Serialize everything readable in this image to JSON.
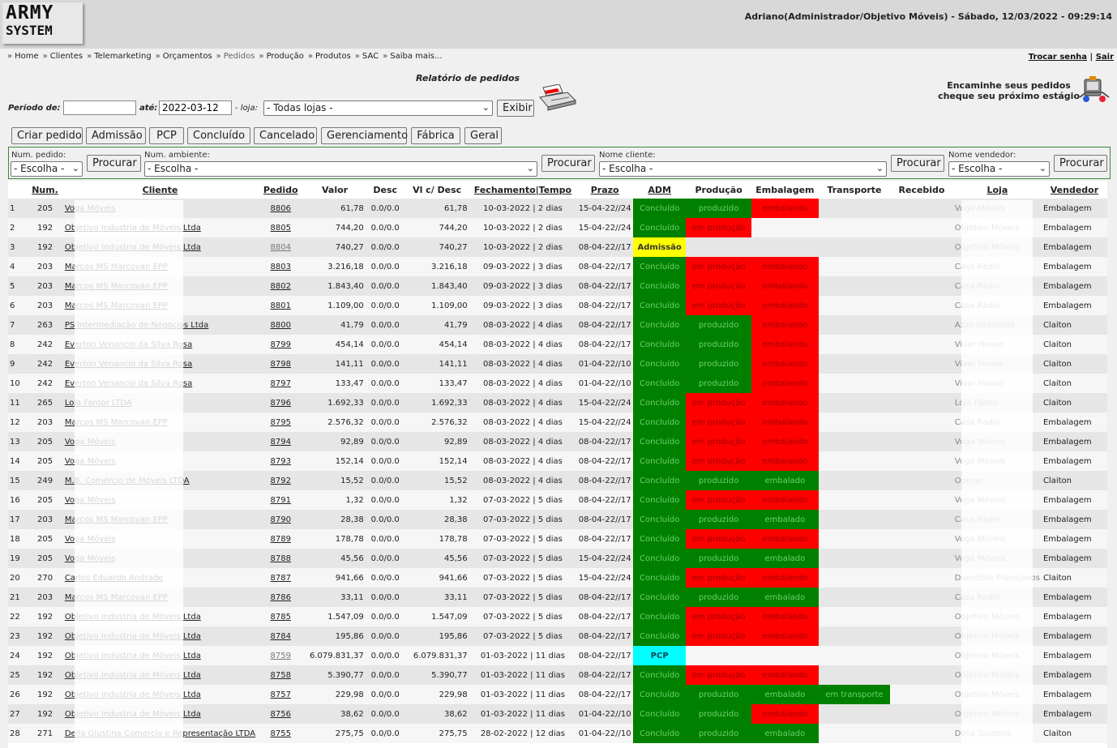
{
  "app": {
    "logo_line1": "ARMY",
    "logo_line2": "SYSTEM",
    "user_info": "Adriano(Administrador/Objetivo Móveis) - Sábado, 12/03/2022 - 09:29:14"
  },
  "nav": {
    "breadcrumb": [
      "Home",
      "Clientes",
      "Telemarketing",
      "Orçamentos",
      "Pedidos",
      "Produção",
      "Produtos",
      "SAC",
      "Saiba mais..."
    ],
    "current": "Pedidos",
    "change_password": "Trocar senha",
    "separator": "|",
    "logout": "Sair"
  },
  "report": {
    "title": "Relatório de pedidos",
    "tip_line1": "Encaminhe seus pedidos",
    "tip_line2": "cheque seu próximo estágio",
    "period_label": "Período de:",
    "period_from": "",
    "until_label": "até:",
    "period_to": "2022-03-12",
    "store_label": "- loja:",
    "store_value": "- Todas lojas -",
    "show_button": "Exibir"
  },
  "tabs": [
    "Criar pedido",
    "Admissão",
    "PCP",
    "Concluído",
    "Cancelado",
    "Gerenciamento",
    "Fábrica",
    "Geral"
  ],
  "filters": {
    "order_label": "Num. pedido:",
    "order_value": "- Escolha -",
    "env_label": "Num. ambiente:",
    "env_value": "- Escolha -",
    "client_label": "Nome cliente:",
    "client_value": "- Escolha -",
    "seller_label": "Nome vendedor:",
    "seller_value": "- Escolha -",
    "search_button": "Procurar"
  },
  "table": {
    "headers": [
      "",
      "Num.",
      "Cliente",
      "Pedido",
      "Valor",
      "Desc",
      "Vl c/ Desc",
      "Fechamento|Tempo",
      "Prazo",
      "ADM",
      "Produção",
      "Embalagem",
      "Transporte",
      "Recebido",
      "Loja",
      "Vendedor"
    ],
    "rows": [
      {
        "i": "1",
        "num": "205",
        "cliente": "Voga Móveis",
        "pedido": "8806",
        "valor": "61,78",
        "desc": "0.0/0.0",
        "vl": "61,78",
        "fech": "10-03-2022 | 2 dias",
        "prazo": "15-04-22//24",
        "adm": "Concluído",
        "prod": "produzido",
        "emb": "embalando",
        "transp": "",
        "receb": "",
        "loja": "Voga Móveis",
        "vend": "Embalagem"
      },
      {
        "i": "2",
        "num": "192",
        "cliente": "Objetivo Industria de Móveis Ltda",
        "pedido": "8805",
        "valor": "744,20",
        "desc": "0.0/0.0",
        "vl": "744,20",
        "fech": "10-03-2022 | 2 dias",
        "prazo": "15-04-22//24",
        "adm": "Concluído",
        "prod": "em produção",
        "emb": "",
        "transp": "",
        "receb": "",
        "loja": "Objetivo Móveis",
        "vend": "Embalagem"
      },
      {
        "i": "3",
        "num": "192",
        "cliente": "Objetivo Industria de Móveis Ltda",
        "pedido": "8804",
        "valor": "740,27",
        "desc": "0.0/0.0",
        "vl": "740,27",
        "fech": "10-03-2022 | 2 dias",
        "prazo": "08-04-22//17",
        "adm": "Admissão",
        "prod": "",
        "emb": "",
        "transp": "",
        "receb": "",
        "loja": "Objetivo Móveis",
        "vend": "Embalagem"
      },
      {
        "i": "4",
        "num": "203",
        "cliente": "Marcos MS Marcovan EPP",
        "pedido": "8803",
        "valor": "3.216,18",
        "desc": "0.0/0.0",
        "vl": "3.216,18",
        "fech": "09-03-2022 | 3 dias",
        "prazo": "08-04-22//17",
        "adm": "Concluído",
        "prod": "em produção",
        "emb": "embalando",
        "transp": "",
        "receb": "",
        "loja": "Casa Radio",
        "vend": "Embalagem"
      },
      {
        "i": "5",
        "num": "203",
        "cliente": "Marcos MS Marcovan EPP",
        "pedido": "8802",
        "valor": "1.843,40",
        "desc": "0.0/0.0",
        "vl": "1.843,40",
        "fech": "09-03-2022 | 3 dias",
        "prazo": "08-04-22//17",
        "adm": "Concluído",
        "prod": "em produção",
        "emb": "embalando",
        "transp": "",
        "receb": "",
        "loja": "Casa Radio",
        "vend": "Embalagem"
      },
      {
        "i": "6",
        "num": "203",
        "cliente": "Marcos MS Marcovan EPP",
        "pedido": "8801",
        "valor": "1.109,00",
        "desc": "0.0/0.0",
        "vl": "1.109,00",
        "fech": "09-03-2022 | 3 dias",
        "prazo": "08-04-22//17",
        "adm": "Concluído",
        "prod": "em produção",
        "emb": "embalando",
        "transp": "",
        "receb": "",
        "loja": "Casa Radio",
        "vend": "Embalagem"
      },
      {
        "i": "7",
        "num": "263",
        "cliente": "PS Intermediação de Negocios Ltda",
        "pedido": "8800",
        "valor": "41,79",
        "desc": "0.0/0.0",
        "vl": "41,79",
        "fech": "08-03-2022 | 4 dias",
        "prazo": "08-04-22//17",
        "adm": "Concluído",
        "prod": "produzido",
        "emb": "embalando",
        "transp": "",
        "receb": "",
        "loja": "Azzo Interiores",
        "vend": "Claiton"
      },
      {
        "i": "8",
        "num": "242",
        "cliente": "Everton Venancio da Silva Rosa",
        "pedido": "8799",
        "valor": "454,14",
        "desc": "0.0/0.0",
        "vl": "454,14",
        "fech": "08-03-2022 | 4 dias",
        "prazo": "08-04-22//17",
        "adm": "Concluído",
        "prod": "produzido",
        "emb": "embalando",
        "transp": "",
        "receb": "",
        "loja": "Vivar House",
        "vend": "Claiton"
      },
      {
        "i": "9",
        "num": "242",
        "cliente": "Everton Venancio da Silva Rosa",
        "pedido": "8798",
        "valor": "141,11",
        "desc": "0.0/0.0",
        "vl": "141,11",
        "fech": "08-03-2022 | 4 dias",
        "prazo": "01-04-22//10",
        "adm": "Concluído",
        "prod": "produzido",
        "emb": "embalando",
        "transp": "",
        "receb": "",
        "loja": "Vivar House",
        "vend": "Claiton"
      },
      {
        "i": "10",
        "num": "242",
        "cliente": "Everton Venancio da Silva Rosa",
        "pedido": "8797",
        "valor": "133,47",
        "desc": "0.0/0.0",
        "vl": "133,47",
        "fech": "08-03-2022 | 4 dias",
        "prazo": "01-04-22//10",
        "adm": "Concluído",
        "prod": "produzido",
        "emb": "embalando",
        "transp": "",
        "receb": "",
        "loja": "Vivar House",
        "vend": "Claiton"
      },
      {
        "i": "11",
        "num": "265",
        "cliente": "Loja Fantor LTDA",
        "pedido": "8796",
        "valor": "1.692,33",
        "desc": "0.0/0.0",
        "vl": "1.692,33",
        "fech": "08-03-2022 | 4 dias",
        "prazo": "15-04-22//24",
        "adm": "Concluído",
        "prod": "em produção",
        "emb": "embalando",
        "transp": "",
        "receb": "",
        "loja": "Loja Fantor",
        "vend": "Claiton"
      },
      {
        "i": "12",
        "num": "203",
        "cliente": "Marcos MS Marcovan EPP",
        "pedido": "8795",
        "valor": "2.576,32",
        "desc": "0.0/0.0",
        "vl": "2.576,32",
        "fech": "08-03-2022 | 4 dias",
        "prazo": "15-04-22//24",
        "adm": "Concluído",
        "prod": "em produção",
        "emb": "embalando",
        "transp": "",
        "receb": "",
        "loja": "Casa Radio",
        "vend": "Embalagem"
      },
      {
        "i": "13",
        "num": "205",
        "cliente": "Voga Móveis",
        "pedido": "8794",
        "valor": "92,89",
        "desc": "0.0/0.0",
        "vl": "92,89",
        "fech": "08-03-2022 | 4 dias",
        "prazo": "08-04-22//17",
        "adm": "Concluído",
        "prod": "em produção",
        "emb": "embalando",
        "transp": "",
        "receb": "",
        "loja": "Voga Móveis",
        "vend": "Embalagem"
      },
      {
        "i": "14",
        "num": "205",
        "cliente": "Voga Móveis",
        "pedido": "8793",
        "valor": "152,14",
        "desc": "0.0/0.0",
        "vl": "152,14",
        "fech": "08-03-2022 | 4 dias",
        "prazo": "08-04-22//17",
        "adm": "Concluído",
        "prod": "em produção",
        "emb": "embalando",
        "transp": "",
        "receb": "",
        "loja": "Voga Móveis",
        "vend": "Embalagem"
      },
      {
        "i": "15",
        "num": "249",
        "cliente": "M.B. Comércio de Móveis LTDA",
        "pedido": "8792",
        "valor": "15,52",
        "desc": "0.0/0.0",
        "vl": "15,52",
        "fech": "08-03-2022 | 4 dias",
        "prazo": "08-04-22//17",
        "adm": "Concluído",
        "prod": "produzido",
        "emb": "embalado",
        "transp": "",
        "receb": "",
        "loja": "Operar",
        "vend": "Claiton"
      },
      {
        "i": "16",
        "num": "205",
        "cliente": "Voga Móveis",
        "pedido": "8791",
        "valor": "1,32",
        "desc": "0.0/0.0",
        "vl": "1,32",
        "fech": "07-03-2022 | 5 dias",
        "prazo": "08-04-22//17",
        "adm": "Concluído",
        "prod": "em produção",
        "emb": "embalando",
        "transp": "",
        "receb": "",
        "loja": "Voga Móveis",
        "vend": "Embalagem"
      },
      {
        "i": "17",
        "num": "203",
        "cliente": "Marcos MS Marcovan EPP",
        "pedido": "8790",
        "valor": "28,38",
        "desc": "0.0/0.0",
        "vl": "28,38",
        "fech": "07-03-2022 | 5 dias",
        "prazo": "08-04-22//17",
        "adm": "Concluído",
        "prod": "produzido",
        "emb": "embalado",
        "transp": "",
        "receb": "",
        "loja": "Casa Radio",
        "vend": "Embalagem"
      },
      {
        "i": "18",
        "num": "205",
        "cliente": "Voga Móveis",
        "pedido": "8789",
        "valor": "178,78",
        "desc": "0.0/0.0",
        "vl": "178,78",
        "fech": "07-03-2022 | 5 dias",
        "prazo": "08-04-22//17",
        "adm": "Concluído",
        "prod": "em produção",
        "emb": "embalando",
        "transp": "",
        "receb": "",
        "loja": "Voga Móveis",
        "vend": "Embalagem"
      },
      {
        "i": "19",
        "num": "205",
        "cliente": "Voga Móveis",
        "pedido": "8788",
        "valor": "45,56",
        "desc": "0.0/0.0",
        "vl": "45,56",
        "fech": "07-03-2022 | 5 dias",
        "prazo": "15-04-22//24",
        "adm": "Concluído",
        "prod": "produzido",
        "emb": "embalado",
        "transp": "",
        "receb": "",
        "loja": "Voga Móveis",
        "vend": "Embalagem"
      },
      {
        "i": "20",
        "num": "270",
        "cliente": "Carlos Eduardo Andrade",
        "pedido": "8787",
        "valor": "941,66",
        "desc": "0.0/0.0",
        "vl": "941,66",
        "fech": "07-03-2022 | 5 dias",
        "prazo": "15-04-22//24",
        "adm": "Concluído",
        "prod": "em produção",
        "emb": "embalando",
        "transp": "",
        "receb": "",
        "loja": "Dumóbile Planejados",
        "vend": "Claiton"
      },
      {
        "i": "21",
        "num": "203",
        "cliente": "Marcos MS Marcovan EPP",
        "pedido": "8786",
        "valor": "33,11",
        "desc": "0.0/0.0",
        "vl": "33,11",
        "fech": "07-03-2022 | 5 dias",
        "prazo": "08-04-22//17",
        "adm": "Concluído",
        "prod": "produzido",
        "emb": "embalado",
        "transp": "",
        "receb": "",
        "loja": "Casa Radio",
        "vend": "Embalagem"
      },
      {
        "i": "22",
        "num": "192",
        "cliente": "Objetivo Industria de Móveis Ltda",
        "pedido": "8785",
        "valor": "1.547,09",
        "desc": "0.0/0.0",
        "vl": "1.547,09",
        "fech": "07-03-2022 | 5 dias",
        "prazo": "08-04-22//17",
        "adm": "Concluído",
        "prod": "em produção",
        "emb": "embalando",
        "transp": "",
        "receb": "",
        "loja": "Objetivo Móveis",
        "vend": "Embalagem"
      },
      {
        "i": "23",
        "num": "192",
        "cliente": "Objetivo Industria de Móveis Ltda",
        "pedido": "8784",
        "valor": "195,86",
        "desc": "0.0/0.0",
        "vl": "195,86",
        "fech": "07-03-2022 | 5 dias",
        "prazo": "08-04-22//17",
        "adm": "Concluído",
        "prod": "em produção",
        "emb": "embalando",
        "transp": "",
        "receb": "",
        "loja": "Objetivo Móveis",
        "vend": "Embalagem"
      },
      {
        "i": "24",
        "num": "192",
        "cliente": "Objetivo Industria de Móveis Ltda",
        "pedido": "8759",
        "valor": "6.079.831,37",
        "desc": "0.0/0.0",
        "vl": "6.079.831,37",
        "fech": "01-03-2022 | 11 dias",
        "prazo": "08-04-22//17",
        "adm": "PCP",
        "prod": "",
        "emb": "",
        "transp": "",
        "receb": "",
        "loja": "Objetivo Móveis",
        "vend": "Embalagem"
      },
      {
        "i": "25",
        "num": "192",
        "cliente": "Objetivo Industria de Móveis Ltda",
        "pedido": "8758",
        "valor": "5.390,77",
        "desc": "0.0/0.0",
        "vl": "5.390,77",
        "fech": "01-03-2022 | 11 dias",
        "prazo": "08-04-22//17",
        "adm": "Concluído",
        "prod": "em produção",
        "emb": "embalando",
        "transp": "",
        "receb": "",
        "loja": "Objetivo Móveis",
        "vend": "Embalagem"
      },
      {
        "i": "26",
        "num": "192",
        "cliente": "Objetivo Industria de Móveis Ltda",
        "pedido": "8757",
        "valor": "229,98",
        "desc": "0.0/0.0",
        "vl": "229,98",
        "fech": "01-03-2022 | 11 dias",
        "prazo": "08-04-22//17",
        "adm": "Concluído",
        "prod": "produzido",
        "emb": "embalado",
        "transp": "em transporte",
        "receb": "",
        "loja": "Objetivo Móveis",
        "vend": "Embalagem"
      },
      {
        "i": "27",
        "num": "192",
        "cliente": "Objetivo Industria de Móveis Ltda",
        "pedido": "8756",
        "valor": "38,62",
        "desc": "0.0/0.0",
        "vl": "38,62",
        "fech": "01-03-2022 | 11 dias",
        "prazo": "01-04-22//10",
        "adm": "Concluído",
        "prod": "produzido",
        "emb": "embalando",
        "transp": "",
        "receb": "",
        "loja": "Objetivo Móveis",
        "vend": "Embalagem"
      },
      {
        "i": "28",
        "num": "271",
        "cliente": "Della Giustina Comercio e Representação LTDA",
        "pedido": "8755",
        "valor": "275,75",
        "desc": "0.0/0.0",
        "vl": "275,75",
        "fech": "28-02-2022 | 12 dias",
        "prazo": "01-04-22//10",
        "adm": "Concluído",
        "prod": "produzido",
        "emb": "embalado",
        "transp": "",
        "receb": "",
        "loja": "Della Giustina",
        "vend": "Claiton"
      }
    ]
  },
  "colors": {
    "green": "#008000",
    "red": "#ff0000",
    "yellow": "#ffff00",
    "cyan": "#00ffff"
  }
}
